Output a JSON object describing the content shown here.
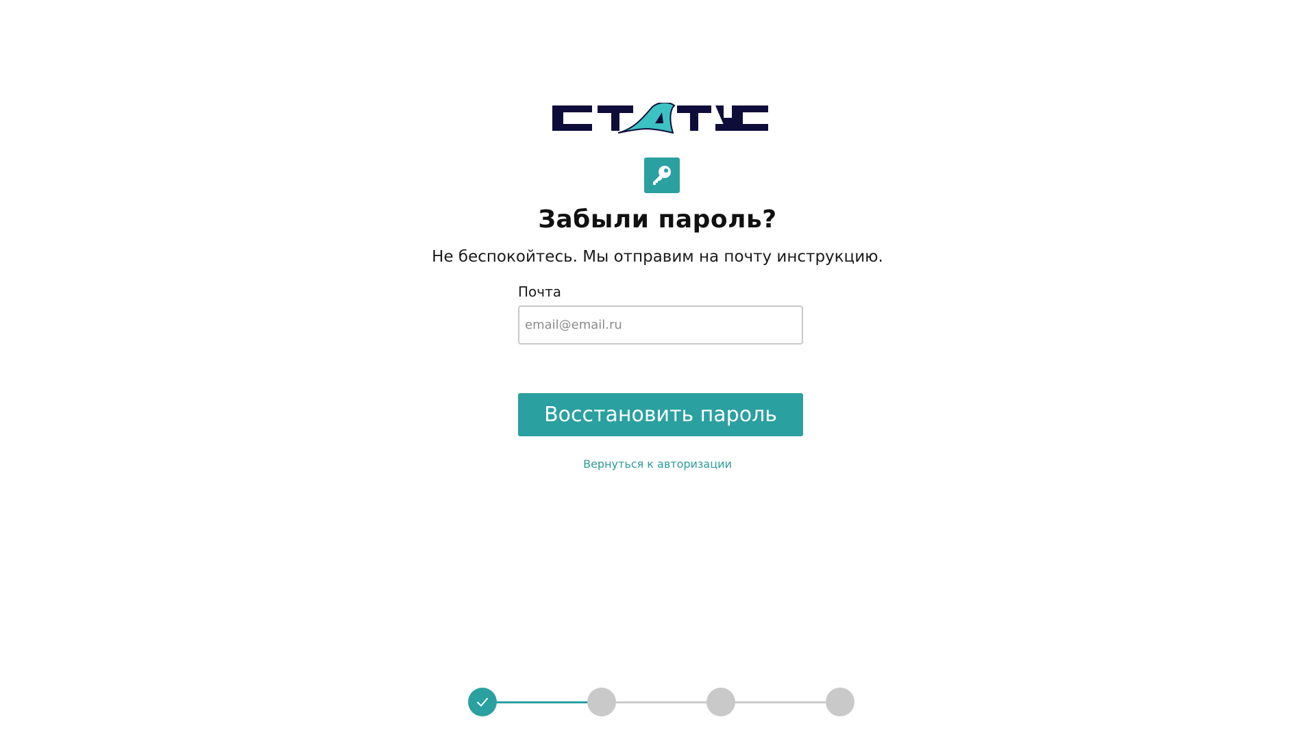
{
  "brand": {
    "logo_text": "СТАТУС",
    "logo_dark": "#0e0d3a",
    "logo_accent": "#3cc2c2"
  },
  "icons": {
    "badge": "key-icon",
    "step_done": "check-icon"
  },
  "colors": {
    "accent": "#2ba0a0",
    "inactive_step": "#c9c9c9",
    "text": "#111111",
    "link": "#2b9a9a"
  },
  "form": {
    "title": "Забыли пароль?",
    "subtitle": "Не беспокойтесь. Мы отправим на почту инструкцию.",
    "email_label": "Почта",
    "email_placeholder": "email@email.ru",
    "email_value": "",
    "submit_label": "Восстановить пароль",
    "back_link": "Вернуться к авторизации"
  },
  "stepper": {
    "total_steps": 4,
    "completed_steps": 1
  }
}
